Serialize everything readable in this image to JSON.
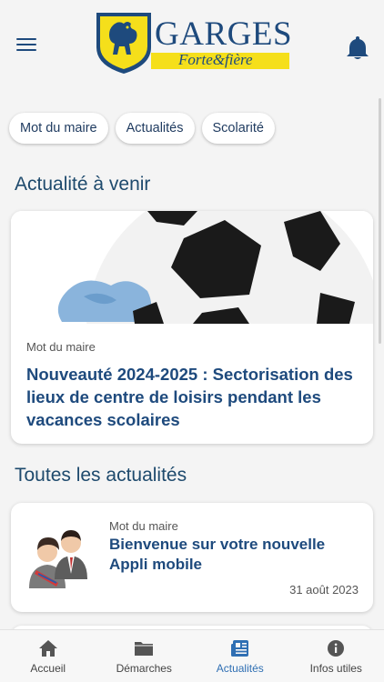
{
  "header": {
    "logo_name": "GARGES",
    "logo_tagline": "Forte&fière",
    "icons": {
      "menu": "hamburger-menu-icon",
      "notifications": "bell-icon"
    },
    "colors": {
      "brand_blue": "#1e4a7d",
      "brand_yellow": "#f5df1b"
    }
  },
  "chips": [
    {
      "label": "Mot du maire"
    },
    {
      "label": "Actualités"
    },
    {
      "label": "Scolarité"
    }
  ],
  "upcoming": {
    "section_title": "Actualité à venir",
    "card": {
      "category": "Mot du maire",
      "title": "Nouveauté 2024-2025 : Sectorisation des lieux de centre de loisirs pendant les vacances scolaires",
      "image": "soccer-ball-image"
    }
  },
  "all_news": {
    "section_title": "Toutes les actualités",
    "items": [
      {
        "category": "Mot du maire",
        "title": "Bienvenue sur votre nouvelle Appli mobile",
        "date": "31 août 2023",
        "image": "mayor-avatars-image"
      }
    ]
  },
  "bottom_nav": {
    "active_color": "#2f6fb3",
    "items": [
      {
        "label": "Accueil",
        "icon": "home-icon",
        "active": false
      },
      {
        "label": "Démarches",
        "icon": "folder-icon",
        "active": false
      },
      {
        "label": "Actualités",
        "icon": "newspaper-icon",
        "active": true
      },
      {
        "label": "Infos utiles",
        "icon": "info-icon",
        "active": false
      }
    ]
  }
}
